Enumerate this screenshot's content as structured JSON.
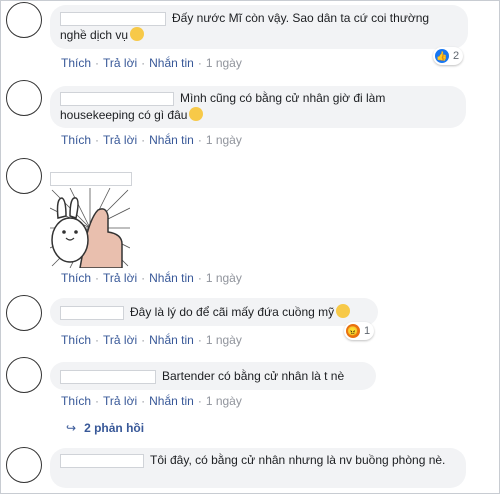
{
  "comments": [
    {
      "text": "Đấy nước Mĩ còn vậy. Sao dân ta cứ coi thường nghề dịch vụ",
      "emoji": "sad-face-emoji",
      "reaction_count": "2",
      "reaction_icon": "like-icon"
    },
    {
      "text": "Mình cũng có bằng cử nhân giờ đi làm housekeeping có gì đâu",
      "emoji": "thinking-face-emoji"
    },
    {
      "sticker": "rabbit-thumbs-up-sticker"
    },
    {
      "text": "Đây là lý do để cãi mấy đứa cuồng mỹ",
      "emoji": "moon-emoji",
      "reaction_count": "1",
      "reaction_icon": "angry-icon"
    },
    {
      "text": "Bartender có bằng cử nhân là t nè",
      "replies_label": "2 phản hồi"
    },
    {
      "text": "Tôi đây, có bằng cử nhân nhưng là nv buồng phòng nè."
    }
  ],
  "actions": {
    "like": "Thích",
    "reply": "Trả lời",
    "message": "Nhắn tin",
    "time": "1 ngày"
  },
  "colors": {
    "link": "#385898",
    "bubble": "#f2f3f5",
    "like": "#1877f2",
    "angry": "#e9710f"
  }
}
